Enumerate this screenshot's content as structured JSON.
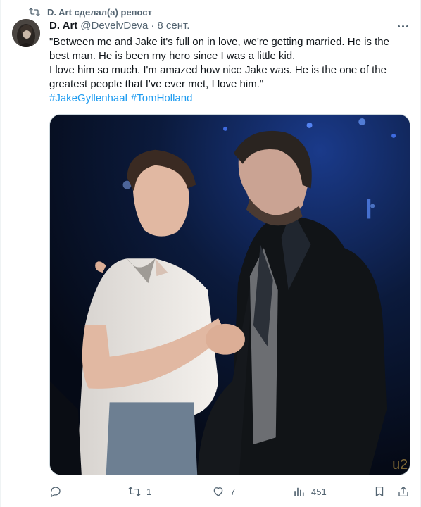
{
  "repost": {
    "label": "D. Art сделал(а) репост"
  },
  "tweet": {
    "author_name": "D. Art",
    "author_handle": "@DevelvDeva",
    "separator": "·",
    "date": "8 сент.",
    "text_lines": [
      "\"Between me and Jake it's full on in love, we're getting married. He is the",
      "best man. He is been my hero since I was a little kid.",
      "I love him so much. I'm amazed how nice Jake was. He is the one of the",
      "greatest people that I've ever met, I love him.\""
    ],
    "hashtags": [
      "#JakeGyllenhaal",
      "#TomHolland"
    ]
  },
  "media": {
    "backdrop_mark": "u2"
  },
  "actions": {
    "reply_count": "",
    "repost_count": "1",
    "like_count": "7",
    "views_count": "451"
  },
  "icons": {
    "repost": "repost-icon",
    "more": "more-icon",
    "reply": "reply-icon",
    "like": "heart-icon",
    "views": "views-icon",
    "bookmark": "bookmark-icon",
    "share": "share-icon"
  },
  "colors": {
    "text": "#0f1419",
    "muted": "#536471",
    "link": "#1d9bf0",
    "border": "#cfd9de"
  }
}
